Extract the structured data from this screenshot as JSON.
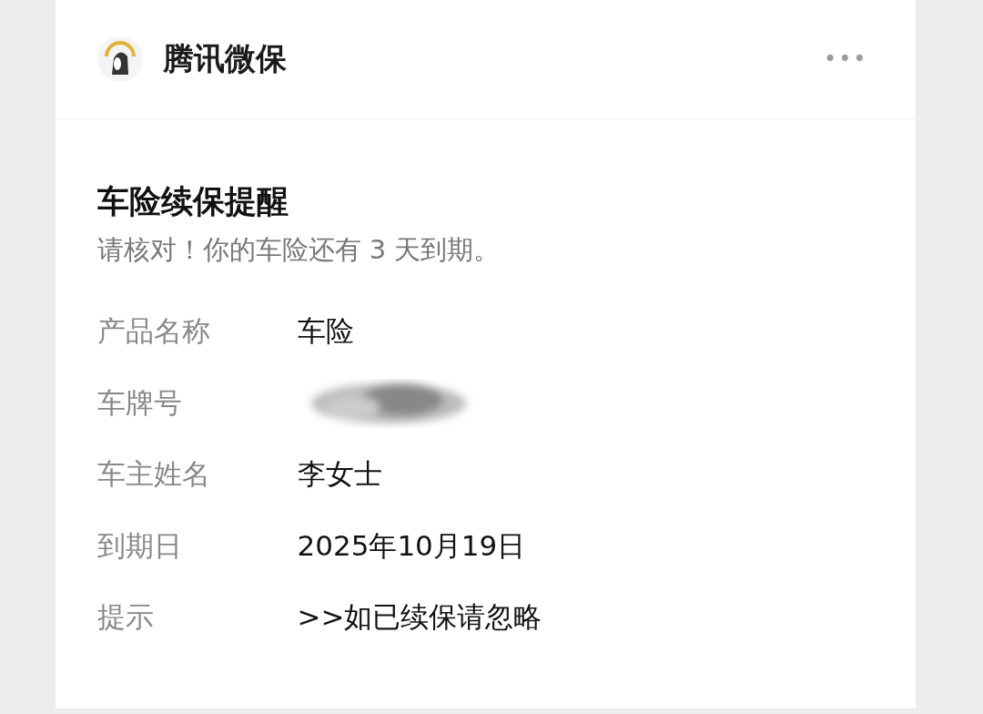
{
  "account": {
    "name": "腾讯微保",
    "menu": "•••"
  },
  "message": {
    "title": "车险续保提醒",
    "subtitle": "请核对！你的车险还有 3 天到期。",
    "fields": [
      {
        "kind": "text",
        "label": "产品名称",
        "value": "车险"
      },
      {
        "kind": "redacted",
        "label": "车牌号"
      },
      {
        "kind": "text",
        "label": "车主姓名",
        "value": "李女士"
      },
      {
        "kind": "text",
        "label": "到期日",
        "value": "2025年10月19日"
      },
      {
        "kind": "text",
        "label": "提示",
        "value": ">>如已续保请忽略"
      }
    ]
  }
}
